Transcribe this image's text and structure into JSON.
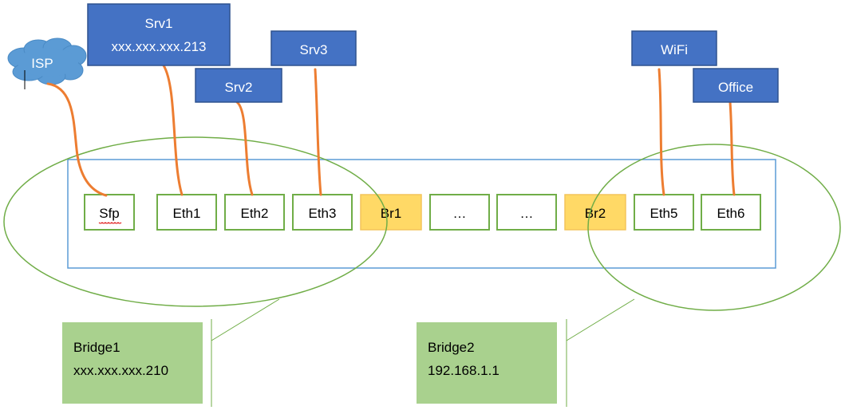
{
  "cloud": {
    "label": "ISP"
  },
  "servers": [
    {
      "label": "Srv1",
      "ip": "xxx.xxx.xxx.213"
    },
    {
      "label": "Srv2"
    },
    {
      "label": "Srv3"
    },
    {
      "label": "WiFi"
    },
    {
      "label": "Office"
    }
  ],
  "ports": [
    {
      "label": "Sfp",
      "type": "port"
    },
    {
      "label": "Eth1",
      "type": "port"
    },
    {
      "label": "Eth2",
      "type": "port"
    },
    {
      "label": "Eth3",
      "type": "port"
    },
    {
      "label": "Br1",
      "type": "bridge"
    },
    {
      "label": "…",
      "type": "port"
    },
    {
      "label": "…",
      "type": "port"
    },
    {
      "label": "Br2",
      "type": "bridge"
    },
    {
      "label": "Eth5",
      "type": "port"
    },
    {
      "label": "Eth6",
      "type": "port"
    }
  ],
  "bridges": [
    {
      "name": "Bridge1",
      "ip": "xxx.xxx.xxx.210"
    },
    {
      "name": "Bridge2",
      "ip": "192.168.1.1"
    }
  ],
  "colors": {
    "server_fill": "#4472c4",
    "cloud_fill": "#5b9bd5",
    "cable": "#ed7d31",
    "group_outline": "#70ad47",
    "device_outline": "#5b9bd5",
    "bridge_port_fill": "#ffd966",
    "callout_fill": "#a9d18e"
  }
}
